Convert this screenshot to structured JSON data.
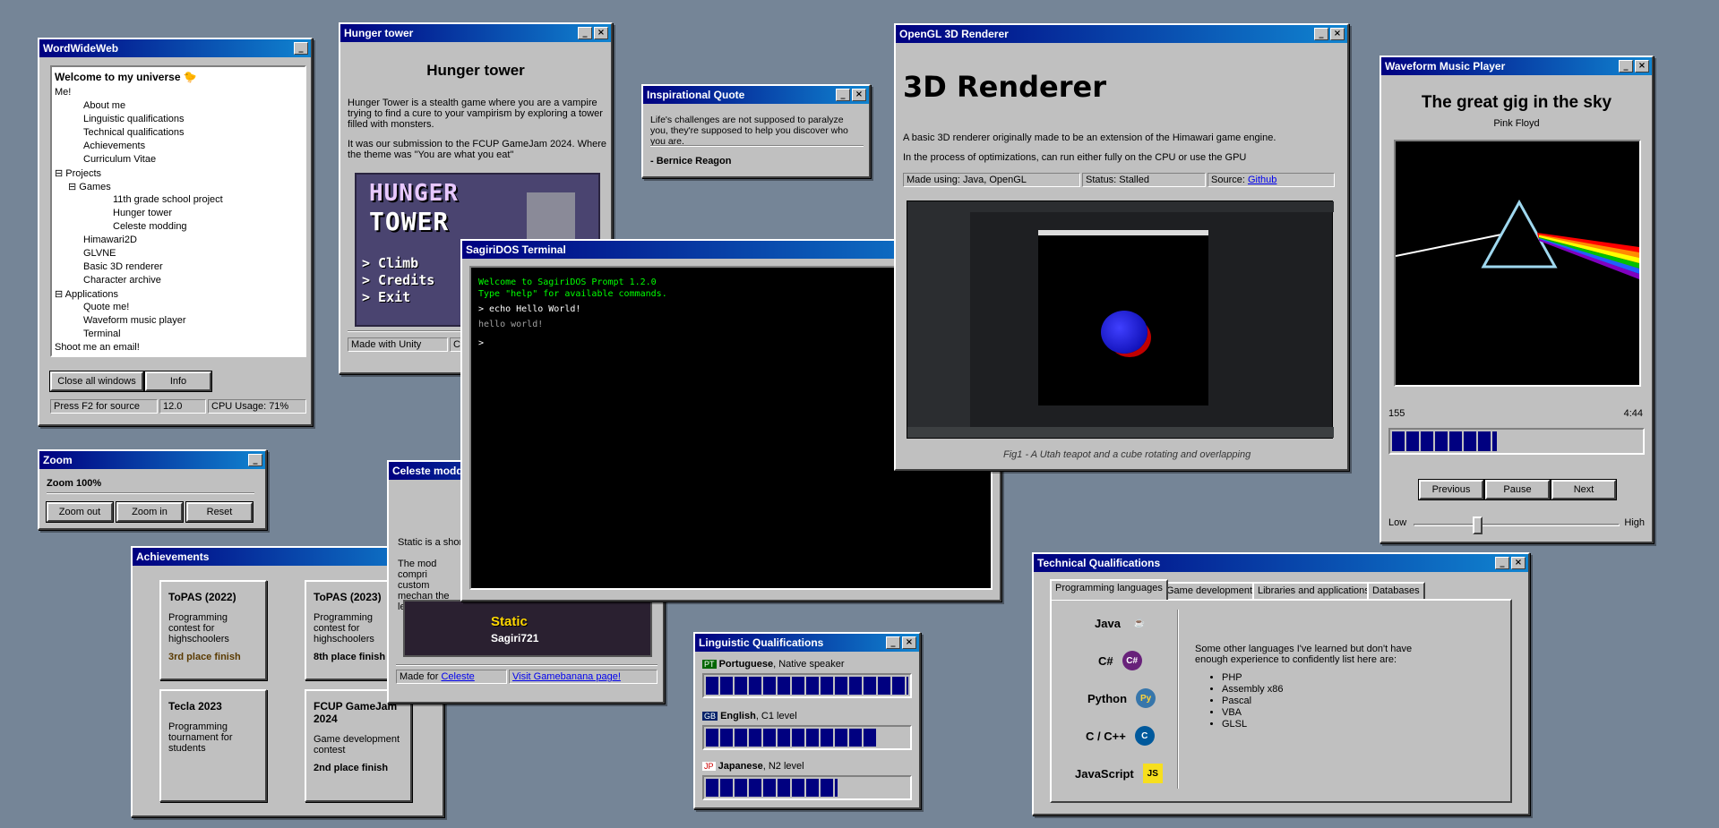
{
  "www": {
    "title": "WordWideWeb",
    "heading": "Welcome to my universe",
    "emoji": "🐤",
    "tree": [
      "Me!",
      "About me",
      "Linguistic qualifications",
      "Technical qualifications",
      "Achievements",
      "Curriculum Vitae",
      "Projects",
      "Games",
      "11th grade school project",
      "Hunger tower",
      "Celeste modding",
      "Himawari2D",
      "GLVNE",
      "Basic 3D renderer",
      "Character archive",
      "Applications",
      "Quote me!",
      "Waveform music player",
      "Terminal",
      "Shoot me an email!"
    ],
    "close_all": "Close all windows",
    "info": "Info",
    "status": [
      "Press F2 for source",
      "12.0",
      "CPU Usage: 71%"
    ]
  },
  "zoom": {
    "title": "Zoom",
    "label": "Zoom 100%",
    "out": "Zoom out",
    "in": "Zoom in",
    "reset": "Reset"
  },
  "achievements": {
    "title": "Achievements",
    "cards": [
      {
        "title": "ToPAS (2022)",
        "desc": "Programming contest for highschoolers",
        "result": "3rd place finish"
      },
      {
        "title": "ToPAS (2023)",
        "desc": "Programming contest for highschoolers",
        "result": "8th place finish"
      },
      {
        "title": "Tecla 2023",
        "desc": "Programming tournament for students",
        "result": ""
      },
      {
        "title": "FCUP GameJam 2024",
        "desc": "Game development contest",
        "result": "2nd place finish"
      }
    ]
  },
  "hunger": {
    "title": "Hunger tower",
    "heading": "Hunger tower",
    "p1": "Hunger Tower is a stealth game where you are a vampire trying to find a cure to your vampirism by exploring a tower filled with monsters.",
    "p2": "It was our submission to the FCUP GameJam 2024. Where the theme was \"You are what you eat\"",
    "logo1": "HUNGER",
    "logo2": "TOWER",
    "menu": [
      "> Climb",
      "> Credits",
      "> Exit"
    ],
    "status": [
      "Made with Unity",
      "C"
    ]
  },
  "quote": {
    "title": "Inspirational Quote",
    "text": "Life's challenges are not supposed to paralyze you, they're supposed to help you discover who you are.",
    "author": "- Bernice Reagon"
  },
  "celeste": {
    "title": "Celeste modding",
    "p1": "Static is a short",
    "p2": "The mod compri custom mechan the level design",
    "banner": "Static",
    "banner_sub": "Sagiri721",
    "made_for": "Made for",
    "made_link": "Celeste",
    "visit": "Visit Gamebanana page!"
  },
  "terminal": {
    "title": "SagiriDOS Terminal",
    "line1": "Welcome to SagiriDOS Prompt 1.2.0",
    "line2": "Type \"help\" for available commands.",
    "cmd": "> echo Hello World!",
    "out": "hello world!",
    "prompt": ">"
  },
  "renderer": {
    "title": "OpenGL 3D Renderer",
    "heading": "3D Renderer",
    "p1": "A basic 3D renderer originally made to be an extension of the Himawari game engine.",
    "p2": "In the process of optimizations, can run either fully on the CPU or use the GPU",
    "made": "Made using: Java, OpenGL",
    "status": "Status: Stalled",
    "source": "Source:",
    "source_link": "Github",
    "caption": "Fig1 - A Utah teapot and a cube rotating and overlapping"
  },
  "music": {
    "title": "Waveform Music Player",
    "song": "The great gig in the sky",
    "artist": "Pink Floyd",
    "time_cur": "155",
    "time_total": "4:44",
    "progress": 0.42,
    "prev": "Previous",
    "pause": "Pause",
    "next": "Next",
    "low": "Low",
    "high": "High",
    "volume": 0.3
  },
  "ling": {
    "title": "Linguistic Qualifications",
    "langs": [
      {
        "flag": "PT",
        "name": "Portuguese",
        "level": ", Native speaker",
        "fill": 1.0
      },
      {
        "flag": "GB",
        "name": "English",
        "level": ", C1 level",
        "fill": 0.85
      },
      {
        "flag": "JP",
        "name": "Japanese",
        "level": ", N2 level",
        "fill": 0.65
      }
    ]
  },
  "tech": {
    "title": "Technical Qualifications",
    "tabs": [
      "Programming languages",
      "Game development",
      "Libraries and applications",
      "Databases"
    ],
    "langs": [
      {
        "name": "Java",
        "icon": "☕"
      },
      {
        "name": "C#",
        "icon": "C#"
      },
      {
        "name": "Python",
        "icon": "Py"
      },
      {
        "name": "C / C++",
        "icon": "C"
      },
      {
        "name": "JavaScript",
        "icon": "JS"
      }
    ],
    "other": "Some other languages I've learned but don't have enough experience to confidently list here are:",
    "list": [
      "PHP",
      "Assembly x86",
      "Pascal",
      "VBA",
      "GLSL"
    ]
  },
  "colors": {
    "titlebar": "#000080",
    "desktop": "#758597",
    "window": "#c0c0c0",
    "terminal_green": "#00ff00"
  }
}
